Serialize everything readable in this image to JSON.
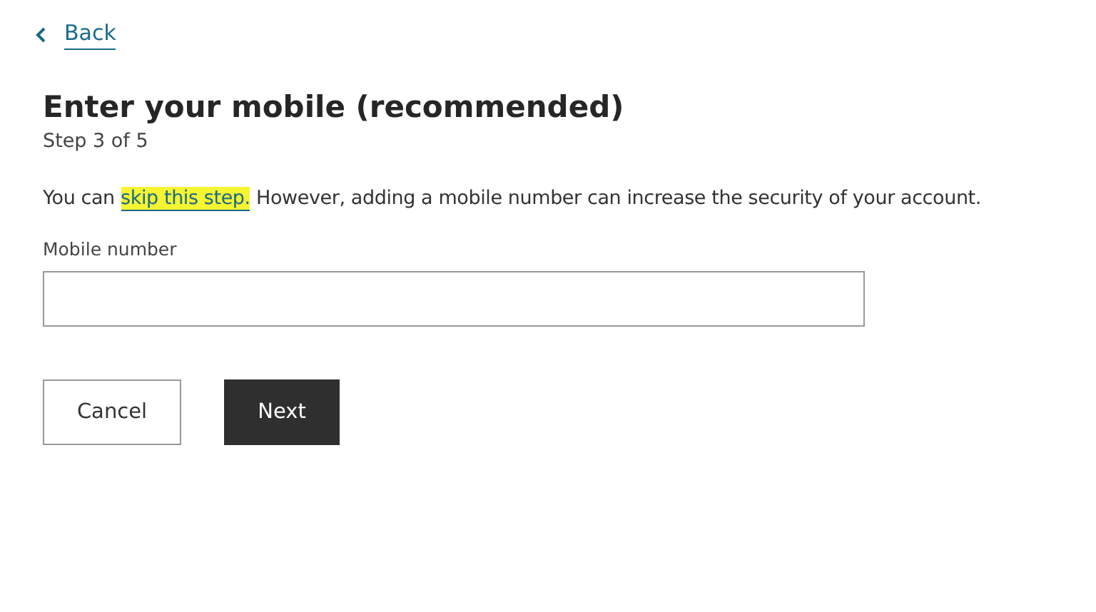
{
  "back_link": {
    "label": "Back"
  },
  "heading": "Enter your mobile (recommended)",
  "step": "Step 3 of 5",
  "intro": {
    "before": "You can",
    "link": "skip this step.",
    "link_highlighted": true,
    "after": "However, adding a mobile number can increase the security of your account."
  },
  "mobile_field": {
    "label": "Mobile number"
  },
  "buttons": [
    {
      "label": "Cancel",
      "kind": "secondary"
    },
    {
      "label": "Next",
      "kind": "primary"
    }
  ]
}
